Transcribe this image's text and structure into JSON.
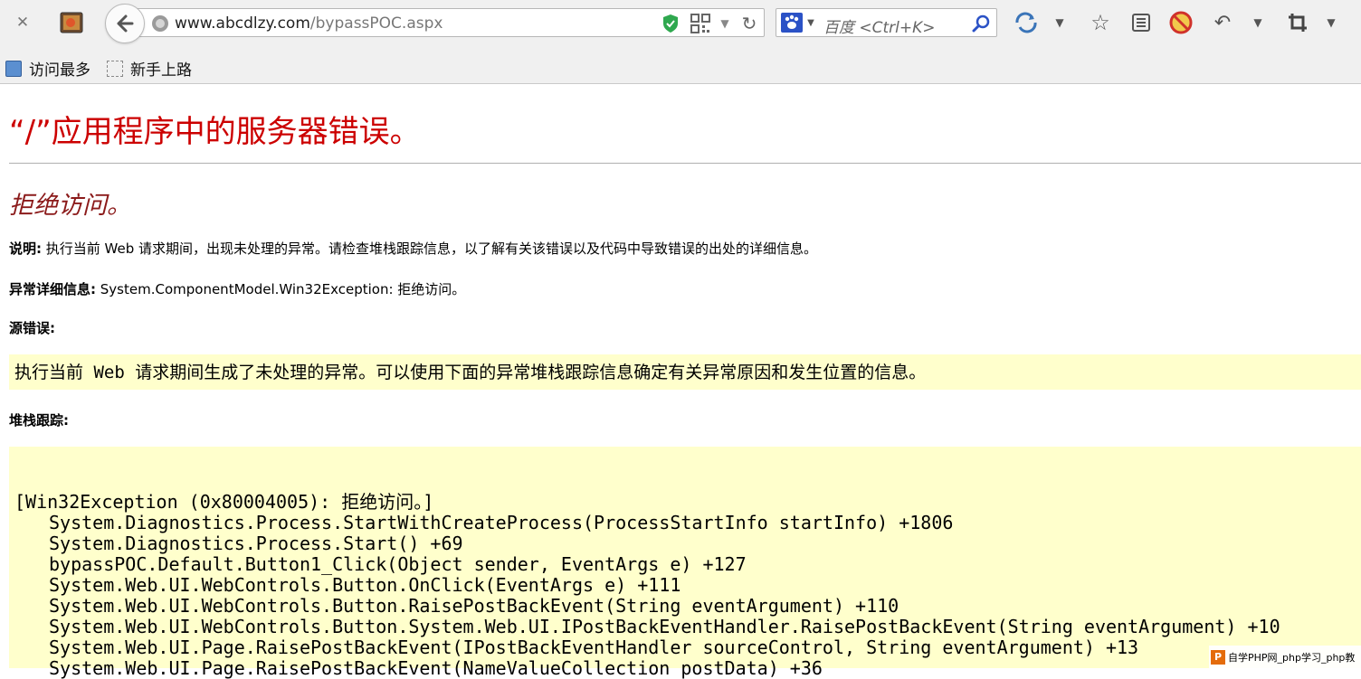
{
  "browser": {
    "url_host": "www.abcdlzy.com",
    "url_path": "/bypassPOC.aspx",
    "search_placeholder": "百度 <Ctrl+K>",
    "bookmarks": [
      {
        "label": "访问最多",
        "icon": "bookmark-site-icon"
      },
      {
        "label": "新手上路",
        "icon": "blank-page-icon"
      }
    ]
  },
  "error_page": {
    "title": "“/”应用程序中的服务器错误。",
    "subtitle": "拒绝访问。",
    "description_label": "说明:",
    "description_text": "执行当前 Web 请求期间，出现未处理的异常。请检查堆栈跟踪信息，以了解有关该错误以及代码中导致错误的出处的详细信息。",
    "exception_label": "异常详细信息:",
    "exception_text": "System.ComponentModel.Win32Exception: 拒绝访问。",
    "source_error_label": "源错误:",
    "source_error_message": "执行当前 Web 请求期间生成了未处理的异常。可以使用下面的异常堆栈跟踪信息确定有关异常原因和发生位置的信息。",
    "stack_trace_label": "堆栈跟踪:",
    "stack_header": "[Win32Exception (0x80004005): 拒绝访问。]",
    "stack_lines": [
      "System.Diagnostics.Process.StartWithCreateProcess(ProcessStartInfo startInfo) +1806",
      "System.Diagnostics.Process.Start() +69",
      "bypassPOC.Default.Button1_Click(Object sender, EventArgs e) +127",
      "System.Web.UI.WebControls.Button.OnClick(EventArgs e) +111",
      "System.Web.UI.WebControls.Button.RaisePostBackEvent(String eventArgument) +110",
      "System.Web.UI.WebControls.Button.System.Web.UI.IPostBackEventHandler.RaisePostBackEvent(String eventArgument) +10",
      "System.Web.UI.Page.RaisePostBackEvent(IPostBackEventHandler sourceControl, String eventArgument) +13",
      "System.Web.UI.Page.RaisePostBackEvent(NameValueCollection postData) +36"
    ]
  },
  "watermark": {
    "logo": "P",
    "text": "自学PHP网_php学习_php教"
  },
  "colors": {
    "title_red": "#cc0000",
    "subtitle_maroon": "#8b1a1a",
    "code_bg": "#ffffcc",
    "chrome_bg": "#f0f0f0"
  }
}
